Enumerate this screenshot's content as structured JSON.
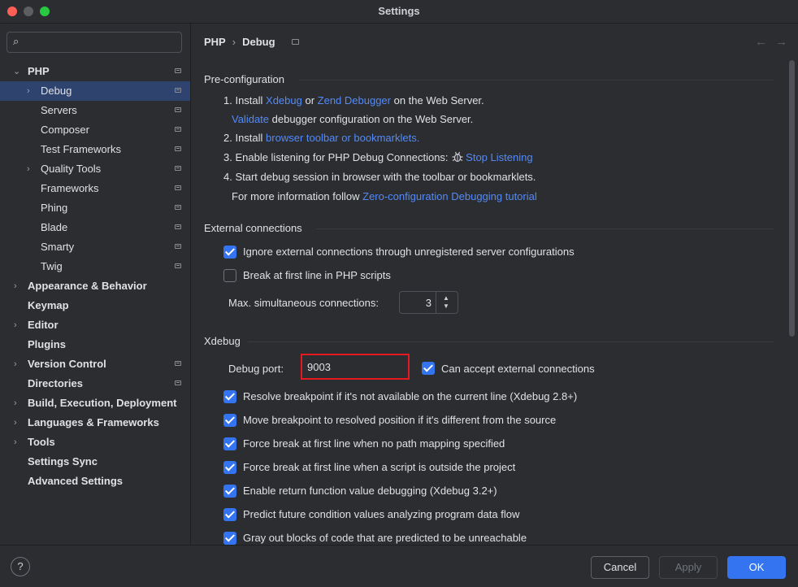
{
  "window": {
    "title": "Settings"
  },
  "sidebar": {
    "search_placeholder": "",
    "items": [
      {
        "label": "PHP",
        "bold": true
      },
      {
        "label": "Debug",
        "bold": false
      },
      {
        "label": "Servers",
        "bold": false
      },
      {
        "label": "Composer",
        "bold": false
      },
      {
        "label": "Test Frameworks",
        "bold": false
      },
      {
        "label": "Quality Tools",
        "bold": false
      },
      {
        "label": "Frameworks",
        "bold": false
      },
      {
        "label": "Phing",
        "bold": false
      },
      {
        "label": "Blade",
        "bold": false
      },
      {
        "label": "Smarty",
        "bold": false
      },
      {
        "label": "Twig",
        "bold": false
      },
      {
        "label": "Appearance & Behavior",
        "bold": true
      },
      {
        "label": "Keymap",
        "bold": true
      },
      {
        "label": "Editor",
        "bold": true
      },
      {
        "label": "Plugins",
        "bold": true
      },
      {
        "label": "Version Control",
        "bold": true
      },
      {
        "label": "Directories",
        "bold": true
      },
      {
        "label": "Build, Execution, Deployment",
        "bold": true
      },
      {
        "label": "Languages & Frameworks",
        "bold": true
      },
      {
        "label": "Tools",
        "bold": true
      },
      {
        "label": "Settings Sync",
        "bold": true
      },
      {
        "label": "Advanced Settings",
        "bold": true
      }
    ]
  },
  "breadcrumb": {
    "parent": "PHP",
    "current": "Debug"
  },
  "preconfig": {
    "heading": "Pre-configuration",
    "step1_prefix": "1. Install ",
    "step1_link1": "Xdebug",
    "step1_or": " or ",
    "step1_link2": "Zend Debugger",
    "step1_suffix": " on the Web Server.",
    "step1b_link": "Validate",
    "step1b_suffix": " debugger configuration on the Web Server.",
    "step2_prefix": "2. Install ",
    "step2_link": "browser toolbar or bookmarklets.",
    "step3_prefix": "3. Enable listening for PHP Debug Connections: ",
    "step3_link": "Stop Listening",
    "step4": "4. Start debug session in browser with the toolbar or bookmarklets.",
    "more_prefix": "For more information follow ",
    "more_link": "Zero-configuration Debugging tutorial"
  },
  "external": {
    "heading": "External connections",
    "ignore_label": "Ignore external connections through unregistered server configurations",
    "break_label": "Break at first line in PHP scripts",
    "max_label": "Max. simultaneous connections:",
    "max_value": "3"
  },
  "xdebug": {
    "heading": "Xdebug",
    "port_label": "Debug port:",
    "port_value": "9003",
    "accept_label": "Can accept external connections",
    "options": [
      "Resolve breakpoint if it's not available on the current line (Xdebug 2.8+)",
      "Move breakpoint to resolved position if it's different from the source",
      "Force break at first line when no path mapping specified",
      "Force break at first line when a script is outside the project",
      "Enable return function value debugging (Xdebug 3.2+)",
      "Predict future condition values analyzing program data flow",
      "Gray out blocks of code that are predicted to be unreachable"
    ]
  },
  "footer": {
    "help": "?",
    "cancel": "Cancel",
    "apply": "Apply",
    "ok": "OK"
  },
  "colors": {
    "accent": "#3574f0",
    "link": "#548af7",
    "highlight": "#e5191f",
    "selection": "#2e436e"
  }
}
